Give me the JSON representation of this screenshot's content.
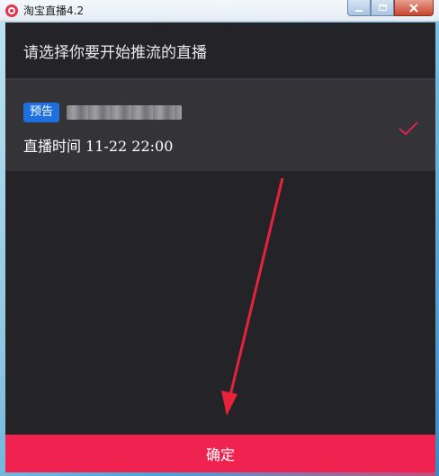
{
  "window": {
    "title": "淘宝直播4.2",
    "icon": "taobao-live-icon"
  },
  "dialog": {
    "title": "请选择你要开始推流的直播",
    "broadcast": {
      "badge": "预告",
      "time_label": "直播时间 11-22 22:00",
      "selected": true,
      "check_icon": "check-icon"
    },
    "confirm_label": "确定"
  },
  "colors": {
    "accent": "#f0224f",
    "badge": "#1e6fe0",
    "dialog_bg": "#232328",
    "item_bg": "#333338"
  }
}
